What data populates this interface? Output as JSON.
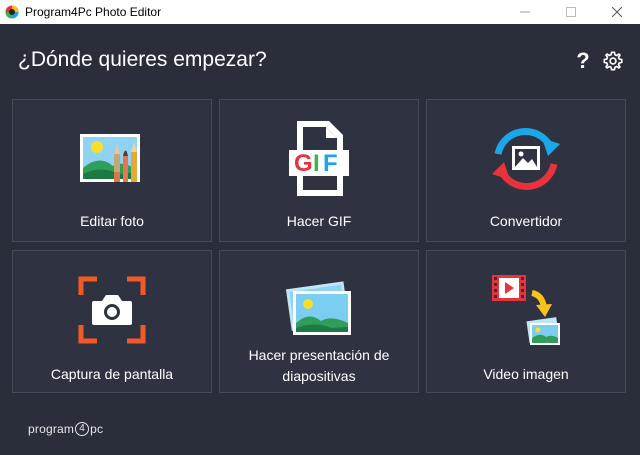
{
  "window": {
    "title": "Program4Pc Photo Editor",
    "minimize_icon": "minimize-icon",
    "maximize_icon": "maximize-icon",
    "close_icon": "close-icon"
  },
  "header": {
    "title": "¿Dónde quieres empezar?",
    "help_label": "?",
    "settings_icon": "gear-icon"
  },
  "tiles": [
    {
      "label": "Editar foto",
      "icon": "photo-edit-icon"
    },
    {
      "label": "Hacer GIF",
      "icon": "gif-file-icon",
      "icon_text": "GIF"
    },
    {
      "label": "Convertidor",
      "icon": "convert-icon"
    },
    {
      "label": "Captura de pantalla",
      "icon": "camera-screenshot-icon"
    },
    {
      "label_line1": "Hacer presentación de",
      "label_line2": "diapositivas",
      "icon": "slideshow-icon"
    },
    {
      "label": "Video imagen",
      "icon": "video-to-image-icon"
    }
  ],
  "footer": {
    "logo_text_a": "program",
    "logo_text_b": "4",
    "logo_text_c": "pc"
  },
  "colors": {
    "background": "#2a2e3a",
    "tile": "#2f3341",
    "tile_border": "#454a5a",
    "accent_orange": "#f15a24",
    "accent_red": "#e8323c",
    "accent_blue": "#1aa7e8"
  }
}
